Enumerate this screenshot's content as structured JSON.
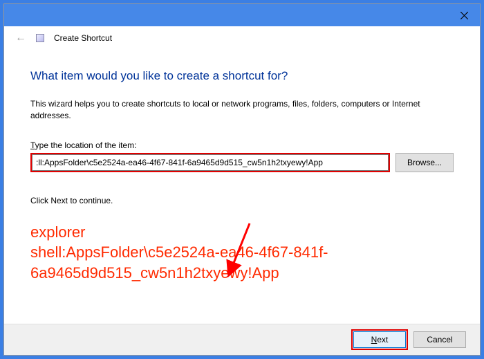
{
  "titlebar": {
    "create_title": "Create Shortcut"
  },
  "content": {
    "heading": "What item would you like to create a shortcut for?",
    "description": "This wizard helps you to create shortcuts to local or network programs, files, folders, computers or Internet addresses.",
    "label_prefix": "T",
    "label_rest": "ype the location of the item:",
    "input_value": ":ll:AppsFolder\\c5e2524a-ea46-4f67-841f-6a9465d9d515_cw5n1h2txyewy!App",
    "browse": "Browse...",
    "continue": "Click Next to continue."
  },
  "annotation": {
    "line1": "explorer",
    "line2": "shell:AppsFolder\\c5e2524a-ea46-4f67-841f-6a9465d9d515_cw5n1h2txyewy!App"
  },
  "footer": {
    "next_prefix": "N",
    "next_rest": "ext",
    "cancel": "Cancel"
  }
}
